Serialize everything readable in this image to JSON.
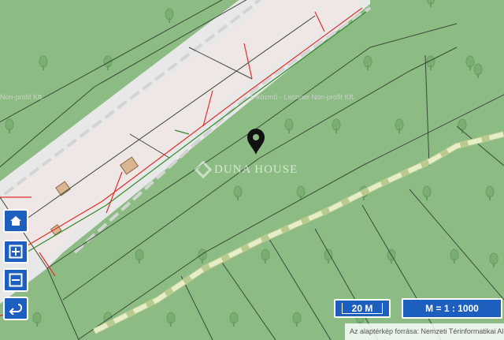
{
  "map": {
    "colors": {
      "forest": "#8cbc83",
      "forest_dark": "#7aae72",
      "road_casing": "#e8e8e8",
      "built_area": "#efe6e6",
      "parcel_line": "#3b4a3b",
      "boundary_red": "#e0302a",
      "boundary_green": "#2d8a2d",
      "path": "#c8d8a4",
      "building": "#d9b690",
      "marker": "#111111"
    },
    "icons": {
      "tree_symbol": "tree-icon",
      "location_marker": "map-pin-icon"
    }
  },
  "watermarks": {
    "left": "Non-profit Kft.",
    "center": "e-közmű - Lechner Non-profit Kft.",
    "brand": "DUNA HOUSE"
  },
  "controls": {
    "home_icon": "home-icon",
    "zoom_in_icon": "zoom-in-icon",
    "zoom_out_icon": "zoom-out-icon",
    "back_icon": "back-icon",
    "accent": "#1d5fbf"
  },
  "scale": {
    "bar_label": "20 M",
    "ratio_label": "M = 1 : 1000"
  },
  "attribution": {
    "text": "Az alaptérkép forrása: Nemzeti Térinformatikai Al"
  }
}
